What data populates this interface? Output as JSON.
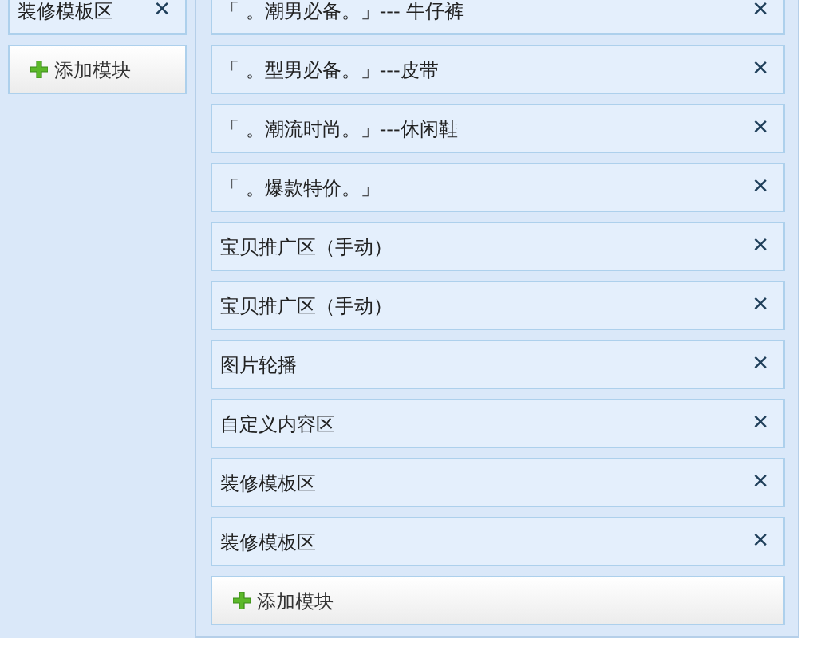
{
  "sidebar": {
    "modules": [
      {
        "title": "装修模板区",
        "close": "✕"
      }
    ],
    "add_button": "添加模块"
  },
  "main": {
    "modules": [
      {
        "title": "「 。潮男必备。」--- 牛仔裤",
        "close": "✕"
      },
      {
        "title": "「 。型男必备。」---皮带",
        "close": "✕"
      },
      {
        "title": "「 。潮流时尚。」---休闲鞋",
        "close": "✕"
      },
      {
        "title": "「 。爆款特价。」",
        "close": "✕"
      },
      {
        "title": "宝贝推广区（手动）",
        "close": "✕"
      },
      {
        "title": "宝贝推广区（手动）",
        "close": "✕"
      },
      {
        "title": "图片轮播",
        "close": "✕"
      },
      {
        "title": "自定义内容区",
        "close": "✕"
      },
      {
        "title": "装修模板区",
        "close": "✕"
      },
      {
        "title": "装修模板区",
        "close": "✕"
      }
    ],
    "add_button": "添加模块"
  }
}
